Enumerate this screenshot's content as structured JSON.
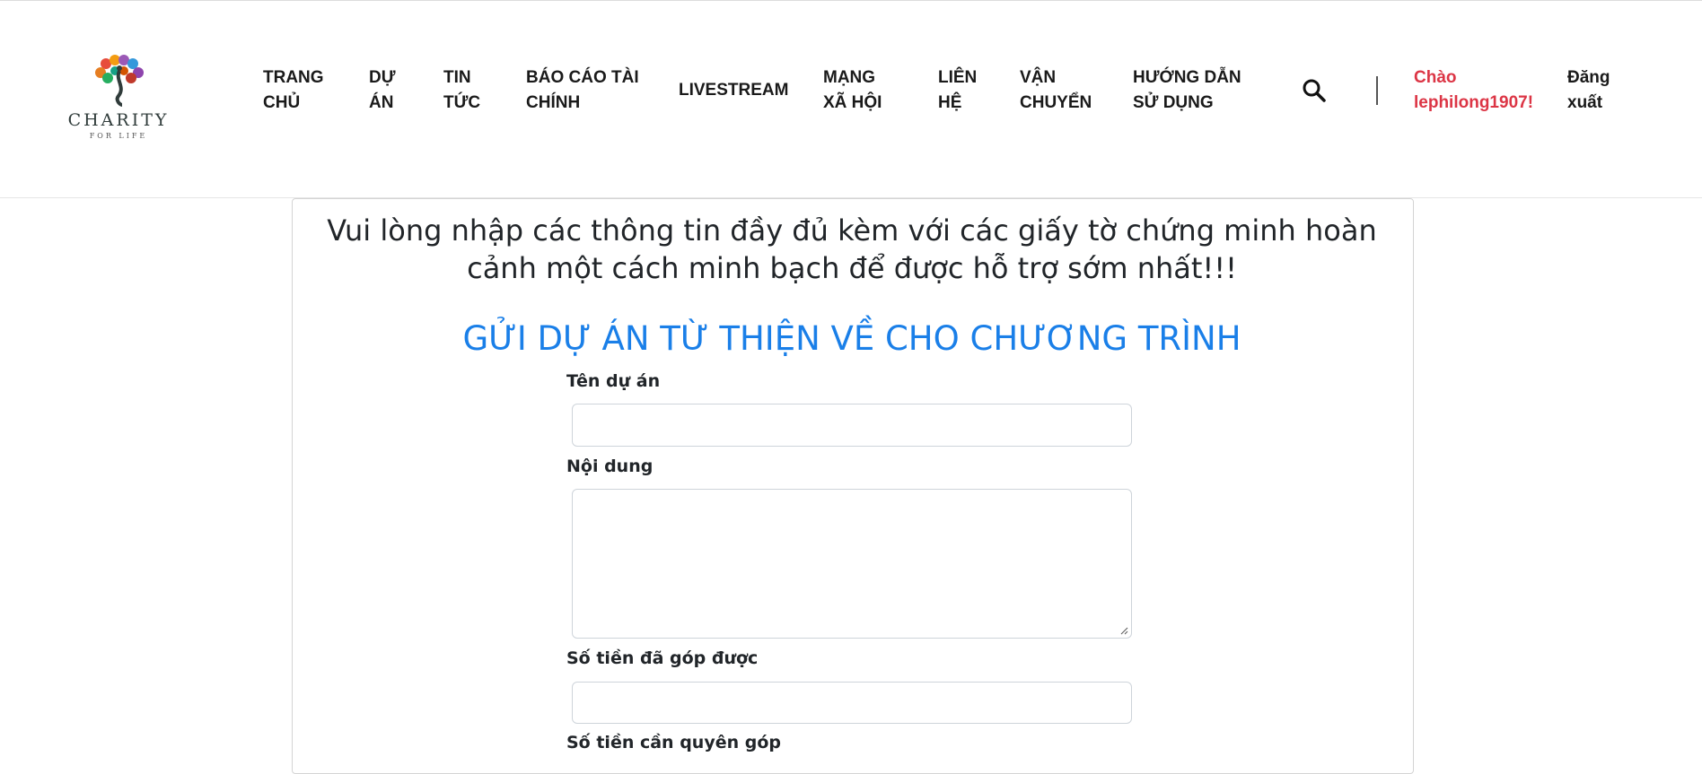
{
  "brand": {
    "name": "CHARITY",
    "tagline": "FOR LIFE"
  },
  "nav": {
    "items": [
      {
        "line1": "TRANG",
        "line2": "CHỦ"
      },
      {
        "line1": "DỰ",
        "line2": "ÁN"
      },
      {
        "line1": "TIN",
        "line2": "TỨC"
      },
      {
        "line1": "BÁO CÁO TÀI",
        "line2": "CHÍNH"
      },
      {
        "line1": "LIVESTREAM",
        "line2": ""
      },
      {
        "line1": "MẠNG",
        "line2": "XÃ HỘI"
      },
      {
        "line1": "LIÊN",
        "line2": "HỆ"
      },
      {
        "line1": "VẬN",
        "line2": "CHUYỂN"
      },
      {
        "line1": "HƯỚNG DẪN",
        "line2": "SỬ DỤNG"
      }
    ],
    "search_icon": "search-icon",
    "greeting": {
      "line1": "Chào",
      "line2": "lephilong1907!"
    },
    "logout": {
      "line1": "Đăng",
      "line2": "xuất"
    }
  },
  "intro": {
    "line1": "Vui lòng nhập các thông tin đầy đủ kèm với các giấy tờ chứng minh hoàn",
    "line2": "cảnh một cách minh bạch để được hỗ trợ sớm nhất!!!"
  },
  "form": {
    "title": "GỬI DỰ ÁN TỪ THIỆN VỀ CHO CHƯƠNG TRÌNH",
    "project_name_label": "Tên dự án",
    "project_name_value": "",
    "content_label": "Nội dung",
    "content_value": "",
    "raised_label": "Số tiền đã góp được",
    "raised_value": "",
    "next_label_partial": "Số tiền cần quyên góp"
  },
  "colors": {
    "accent": "#1a7fe8",
    "greeting": "#dc3545",
    "text": "#212529"
  }
}
